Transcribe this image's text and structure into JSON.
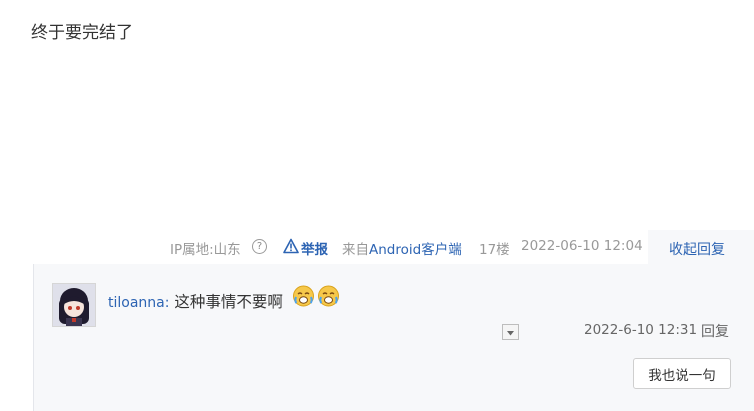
{
  "post": {
    "content": "终于要完结了"
  },
  "meta": {
    "ip_location": "IP属地:山东",
    "help_icon": "question-circle-icon",
    "report_label": "举报",
    "report_icon": "warning-triangle-icon",
    "from_prefix": "来自",
    "client": "Android客户端",
    "floor": "17楼",
    "time": "2022-06-10 12:04",
    "collapse_label": "收起回复"
  },
  "reply": {
    "username": "tiloanna:",
    "text": " 这种事情不要啊",
    "emoji_icons": [
      "crying-face-icon",
      "crying-face-icon"
    ],
    "time": "2022-6-10 12:31",
    "reply_label": "回复",
    "say_button": "我也说一句"
  },
  "colors": {
    "link": "#2d64b3",
    "meta_text": "#999999",
    "panel_bg": "#f7f8fa"
  }
}
